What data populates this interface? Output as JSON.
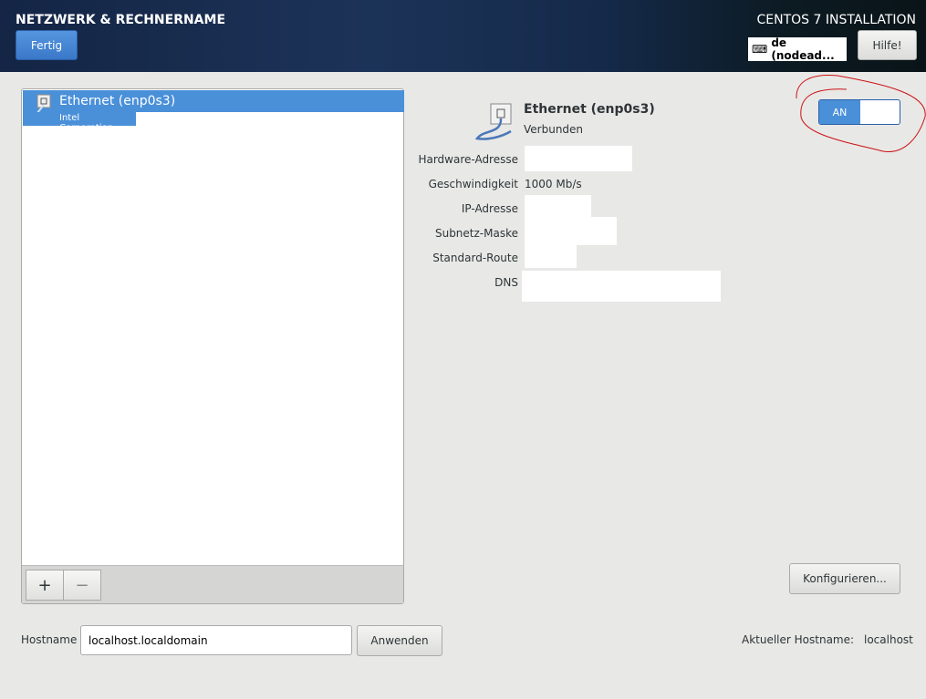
{
  "header": {
    "title": "NETZWERK & RECHNERNAME",
    "done_label": "Fertig",
    "product": "CENTOS 7 INSTALLATION",
    "keyboard_layout": "de (nodead...",
    "help_label": "Hilfe!"
  },
  "devices": [
    {
      "name": "Ethernet (enp0s3)",
      "vendor": "Intel Corporation"
    }
  ],
  "toolbar": {
    "add": "+",
    "remove": "−"
  },
  "detail": {
    "name": "Ethernet (enp0s3)",
    "status": "Verbunden",
    "fields": [
      {
        "label": "Hardware-Adresse",
        "value": ""
      },
      {
        "label": "Geschwindigkeit",
        "value": "1000 Mb/s"
      },
      {
        "label": "IP-Adresse",
        "value": ""
      },
      {
        "label": "Subnetz-Maske",
        "value": ""
      },
      {
        "label": "Standard-Route",
        "value": ""
      },
      {
        "label": "DNS",
        "value": ""
      }
    ],
    "toggle_label": "AN",
    "toggle_on": true,
    "configure_label": "Konfigurieren..."
  },
  "hostname": {
    "label": "Hostname",
    "value": "localhost.localdomain",
    "apply_label": "Anwenden",
    "current_label": "Aktueller Hostname:",
    "current_value": "localhost"
  },
  "colors": {
    "accent": "#4a90d9",
    "annotation": "#cc1111"
  }
}
